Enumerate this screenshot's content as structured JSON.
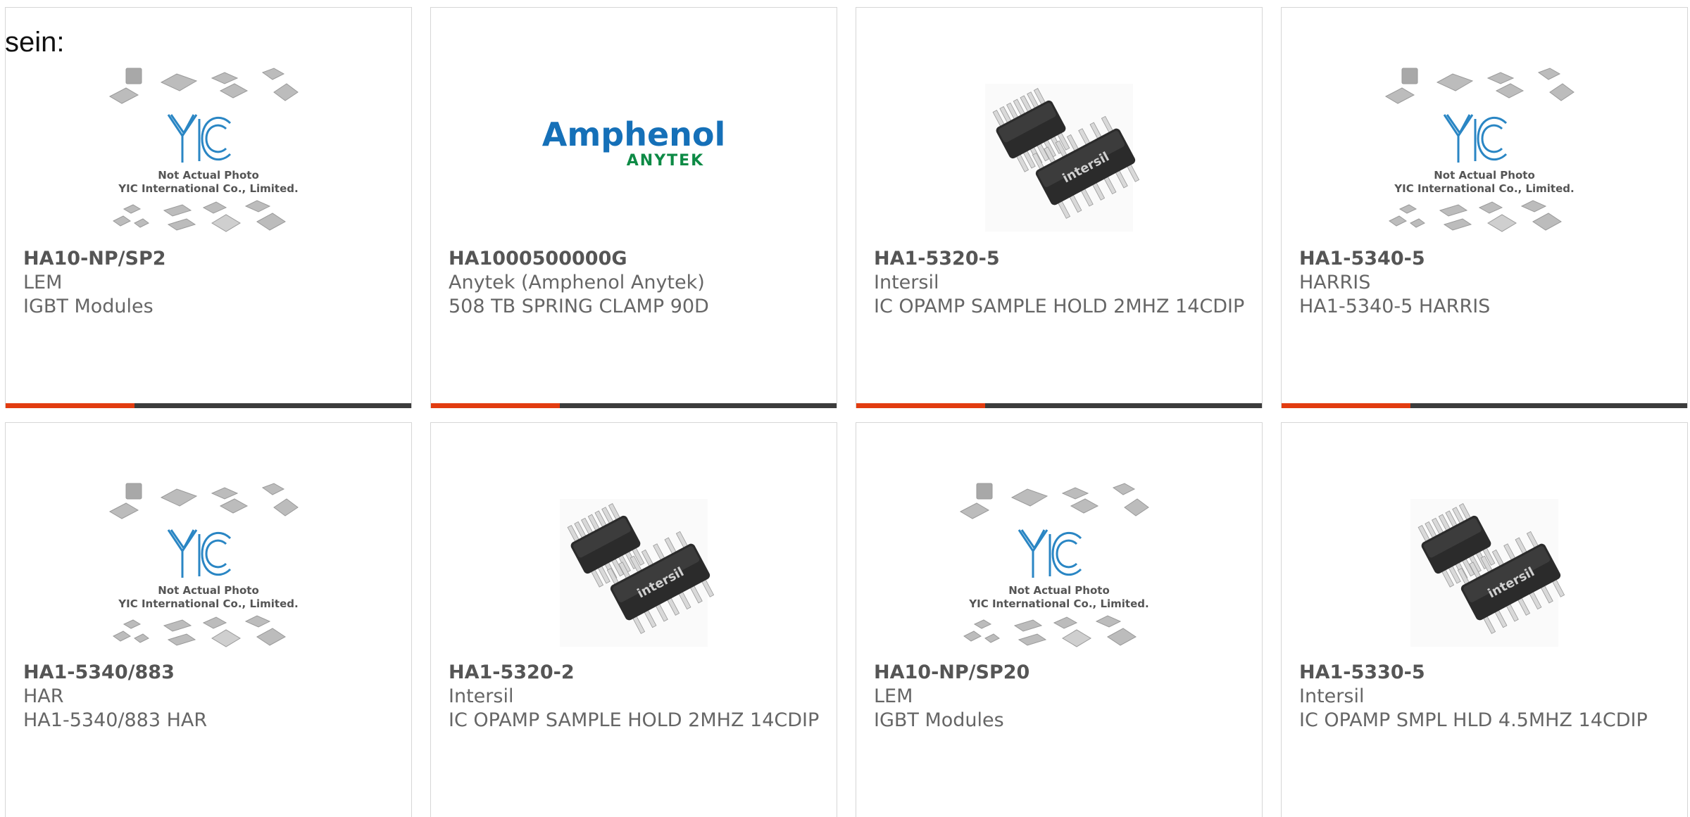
{
  "intro_text": "sein:",
  "placeholder_caption": {
    "line1": "Not Actual Photo",
    "line2": "YIC International Co., Limited.",
    "logo": "YIC"
  },
  "brand_logo": {
    "name": "Amphenol",
    "sub": "ANYTEK"
  },
  "chip_brand": "intersil",
  "colors": {
    "accent": "#e23c10",
    "bar": "#3c3c3c",
    "yic_blue": "#2a86c4",
    "amphenol_blue": "#1570b8",
    "anytek_green": "#0d8a45"
  },
  "products": [
    {
      "part": "HA10-NP/SP2",
      "manufacturer": "LEM",
      "description": "IGBT Modules",
      "image": "placeholder-photo"
    },
    {
      "part": "HA1000500000G",
      "manufacturer": "Anytek (Amphenol Anytek)",
      "description": "508 TB SPRING CLAMP 90D",
      "image": "amphenol-logo"
    },
    {
      "part": "HA1-5320-5",
      "manufacturer": "Intersil",
      "description": "IC OPAMP SAMPLE HOLD 2MHZ 14CDIP",
      "image": "dip-chip-photo"
    },
    {
      "part": "HA1-5340-5",
      "manufacturer": "HARRIS",
      "description": "HA1-5340-5 HARRIS",
      "image": "placeholder-photo"
    },
    {
      "part": "HA1-5340/883",
      "manufacturer": "HAR",
      "description": "HA1-5340/883 HAR",
      "image": "placeholder-photo"
    },
    {
      "part": "HA1-5320-2",
      "manufacturer": "Intersil",
      "description": "IC OPAMP SAMPLE HOLD 2MHZ 14CDIP",
      "image": "dip-chip-photo"
    },
    {
      "part": "HA10-NP/SP20",
      "manufacturer": "LEM",
      "description": "IGBT Modules",
      "image": "placeholder-photo"
    },
    {
      "part": "HA1-5330-5",
      "manufacturer": "Intersil",
      "description": "IC OPAMP SMPL HLD 4.5MHZ 14CDIP",
      "image": "dip-chip-photo"
    }
  ]
}
